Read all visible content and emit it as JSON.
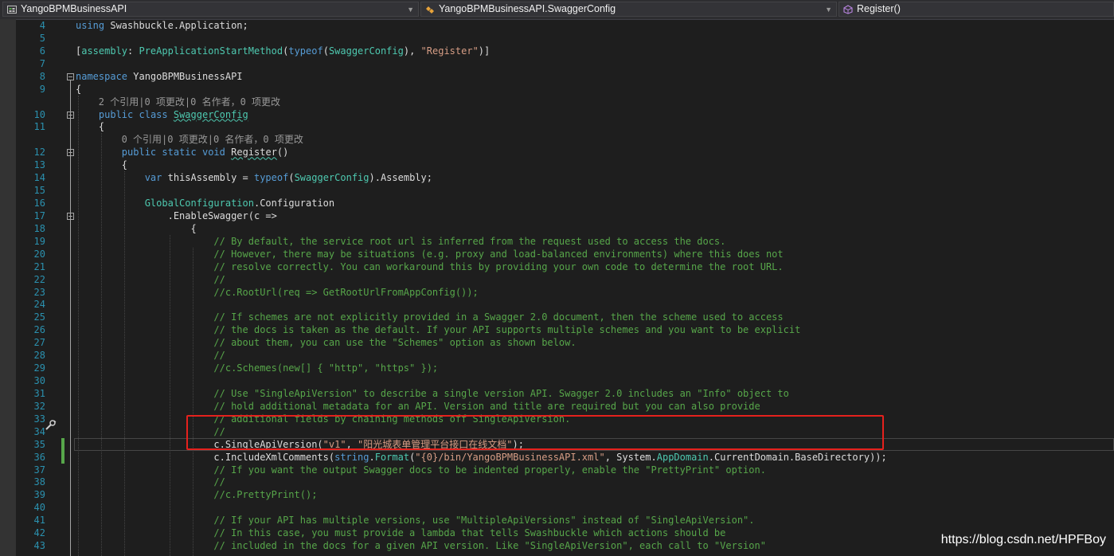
{
  "nav": {
    "project": "YangoBPMBusinessAPI",
    "type": "YangoBPMBusinessAPI.SwaggerConfig",
    "member": "Register()"
  },
  "watermark": "https://blog.csdn.net/HPFBoy",
  "lines": [
    {
      "n": "4",
      "segs": [
        [
          "k",
          "using"
        ],
        [
          "p",
          " Swashbuckle.Application;"
        ]
      ]
    },
    {
      "n": "5",
      "segs": []
    },
    {
      "n": "6",
      "segs": [
        [
          "p",
          "["
        ],
        [
          "t",
          "assembly"
        ],
        [
          "p",
          ": "
        ],
        [
          "t",
          "PreApplicationStartMethod"
        ],
        [
          "p",
          "("
        ],
        [
          "k",
          "typeof"
        ],
        [
          "p",
          "("
        ],
        [
          "t",
          "SwaggerConfig"
        ],
        [
          "p",
          "), "
        ],
        [
          "s",
          "\"Register\""
        ],
        [
          "p",
          ")]"
        ]
      ]
    },
    {
      "n": "7",
      "segs": []
    },
    {
      "n": "8",
      "segs": [
        [
          "k",
          "namespace"
        ],
        [
          "p",
          " YangoBPMBusinessAPI"
        ]
      ]
    },
    {
      "n": "9",
      "segs": [
        [
          "p",
          "{"
        ]
      ]
    },
    {
      "lens": "2 个引用|0 项更改|0 名作者，0 项更改"
    },
    {
      "n": "10",
      "segs": [
        [
          "p",
          "    "
        ],
        [
          "k",
          "public"
        ],
        [
          "p",
          " "
        ],
        [
          "k",
          "class"
        ],
        [
          "p",
          " "
        ],
        [
          "tsq",
          "SwaggerConfig"
        ]
      ]
    },
    {
      "n": "11",
      "segs": [
        [
          "p",
          "    {"
        ]
      ]
    },
    {
      "lens": "0 个引用|0 项更改|0 名作者，0 项更改"
    },
    {
      "n": "12",
      "segs": [
        [
          "p",
          "        "
        ],
        [
          "k",
          "public"
        ],
        [
          "p",
          " "
        ],
        [
          "k",
          "static"
        ],
        [
          "p",
          " "
        ],
        [
          "k",
          "void"
        ],
        [
          "p",
          " "
        ],
        [
          "psq",
          "Register"
        ],
        [
          "p",
          "()"
        ]
      ]
    },
    {
      "n": "13",
      "segs": [
        [
          "p",
          "        {"
        ]
      ]
    },
    {
      "n": "14",
      "segs": [
        [
          "p",
          "            "
        ],
        [
          "k",
          "var"
        ],
        [
          "p",
          " thisAssembly = "
        ],
        [
          "k",
          "typeof"
        ],
        [
          "p",
          "("
        ],
        [
          "t",
          "SwaggerConfig"
        ],
        [
          "p",
          ").Assembly;"
        ]
      ]
    },
    {
      "n": "15",
      "segs": []
    },
    {
      "n": "16",
      "segs": [
        [
          "p",
          "            "
        ],
        [
          "t",
          "GlobalConfiguration"
        ],
        [
          "p",
          ".Configuration"
        ]
      ]
    },
    {
      "n": "17",
      "segs": [
        [
          "p",
          "                .EnableSwagger(c =>"
        ]
      ]
    },
    {
      "n": "18",
      "segs": [
        [
          "p",
          "                    {"
        ]
      ]
    },
    {
      "n": "19",
      "segs": [
        [
          "p",
          "                        "
        ],
        [
          "c",
          "// By default, the service root url is inferred from the request used to access the docs."
        ]
      ]
    },
    {
      "n": "20",
      "segs": [
        [
          "p",
          "                        "
        ],
        [
          "c",
          "// However, there may be situations (e.g. proxy and load-balanced environments) where this does not"
        ]
      ]
    },
    {
      "n": "21",
      "segs": [
        [
          "p",
          "                        "
        ],
        [
          "c",
          "// resolve correctly. You can workaround this by providing your own code to determine the root URL."
        ]
      ]
    },
    {
      "n": "22",
      "segs": [
        [
          "p",
          "                        "
        ],
        [
          "c",
          "//"
        ]
      ]
    },
    {
      "n": "23",
      "segs": [
        [
          "p",
          "                        "
        ],
        [
          "c",
          "//c.RootUrl(req => GetRootUrlFromAppConfig());"
        ]
      ]
    },
    {
      "n": "24",
      "segs": []
    },
    {
      "n": "25",
      "segs": [
        [
          "p",
          "                        "
        ],
        [
          "c",
          "// If schemes are not explicitly provided in a Swagger 2.0 document, then the scheme used to access"
        ]
      ]
    },
    {
      "n": "26",
      "segs": [
        [
          "p",
          "                        "
        ],
        [
          "c",
          "// the docs is taken as the default. If your API supports multiple schemes and you want to be explicit"
        ]
      ]
    },
    {
      "n": "27",
      "segs": [
        [
          "p",
          "                        "
        ],
        [
          "c",
          "// about them, you can use the \"Schemes\" option as shown below."
        ]
      ]
    },
    {
      "n": "28",
      "segs": [
        [
          "p",
          "                        "
        ],
        [
          "c",
          "//"
        ]
      ]
    },
    {
      "n": "29",
      "segs": [
        [
          "p",
          "                        "
        ],
        [
          "c",
          "//c.Schemes(new[] { \"http\", \"https\" });"
        ]
      ]
    },
    {
      "n": "30",
      "segs": []
    },
    {
      "n": "31",
      "segs": [
        [
          "p",
          "                        "
        ],
        [
          "c",
          "// Use \"SingleApiVersion\" to describe a single version API. Swagger 2.0 includes an \"Info\" object to"
        ]
      ]
    },
    {
      "n": "32",
      "segs": [
        [
          "p",
          "                        "
        ],
        [
          "c",
          "// hold additional metadata for an API. Version and title are required but you can also provide"
        ]
      ]
    },
    {
      "n": "33",
      "segs": [
        [
          "p",
          "                        "
        ],
        [
          "c",
          "// additional fields by chaining methods off SingleApiVersion."
        ]
      ]
    },
    {
      "n": "34",
      "segs": [
        [
          "p",
          "                        "
        ],
        [
          "c",
          "//"
        ]
      ]
    },
    {
      "n": "35",
      "segs": [
        [
          "p",
          "                        c.SingleApiVersion("
        ],
        [
          "s",
          "\"v1\""
        ],
        [
          "p",
          ", "
        ],
        [
          "s",
          "\"阳光城表单管理平台接口在线文档\""
        ],
        [
          "p",
          ");"
        ]
      ]
    },
    {
      "n": "36",
      "segs": [
        [
          "p",
          "                        c.IncludeXmlComments("
        ],
        [
          "k",
          "string"
        ],
        [
          "p",
          "."
        ],
        [
          "t",
          "Format"
        ],
        [
          "p",
          "("
        ],
        [
          "s",
          "\"{0}/bin/YangoBPMBusinessAPI.xml\""
        ],
        [
          "p",
          ", System."
        ],
        [
          "t",
          "AppDomain"
        ],
        [
          "p",
          ".CurrentDomain.BaseDirectory));"
        ]
      ]
    },
    {
      "n": "37",
      "segs": [
        [
          "p",
          "                        "
        ],
        [
          "c",
          "// If you want the output Swagger docs to be indented properly, enable the \"PrettyPrint\" option."
        ]
      ]
    },
    {
      "n": "38",
      "segs": [
        [
          "p",
          "                        "
        ],
        [
          "c",
          "//"
        ]
      ]
    },
    {
      "n": "39",
      "segs": [
        [
          "p",
          "                        "
        ],
        [
          "c",
          "//c.PrettyPrint();"
        ]
      ]
    },
    {
      "n": "40",
      "segs": []
    },
    {
      "n": "41",
      "segs": [
        [
          "p",
          "                        "
        ],
        [
          "c",
          "// If your API has multiple versions, use \"MultipleApiVersions\" instead of \"SingleApiVersion\"."
        ]
      ]
    },
    {
      "n": "42",
      "segs": [
        [
          "p",
          "                        "
        ],
        [
          "c",
          "// In this case, you must provide a lambda that tells Swashbuckle which actions should be"
        ]
      ]
    },
    {
      "n": "43",
      "segs": [
        [
          "p",
          "                        "
        ],
        [
          "c",
          "// included in the docs for a given API version. Like \"SingleApiVersion\", each call to \"Version\""
        ]
      ]
    }
  ]
}
